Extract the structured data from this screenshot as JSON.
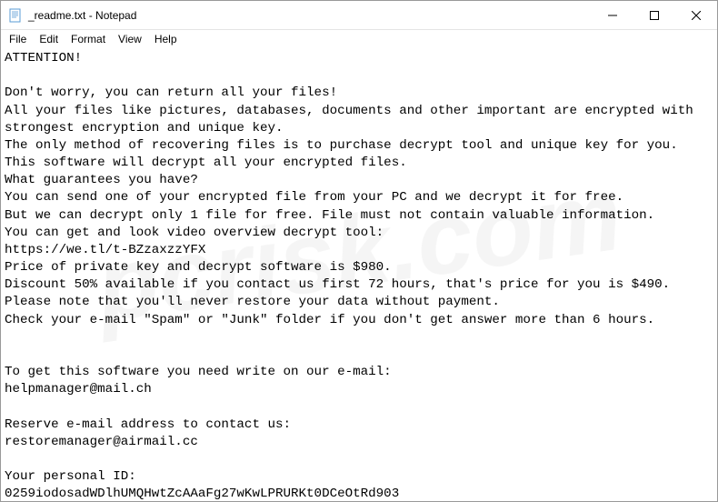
{
  "window": {
    "title": "_readme.txt - Notepad"
  },
  "menubar": {
    "items": [
      "File",
      "Edit",
      "Format",
      "View",
      "Help"
    ]
  },
  "content": {
    "text": "ATTENTION!\n\nDon't worry, you can return all your files!\nAll your files like pictures, databases, documents and other important are encrypted with strongest encryption and unique key.\nThe only method of recovering files is to purchase decrypt tool and unique key for you.\nThis software will decrypt all your encrypted files.\nWhat guarantees you have?\nYou can send one of your encrypted file from your PC and we decrypt it for free.\nBut we can decrypt only 1 file for free. File must not contain valuable information.\nYou can get and look video overview decrypt tool:\nhttps://we.tl/t-BZzaxzzYFX\nPrice of private key and decrypt software is $980.\nDiscount 50% available if you contact us first 72 hours, that's price for you is $490.\nPlease note that you'll never restore your data without payment.\nCheck your e-mail \"Spam\" or \"Junk\" folder if you don't get answer more than 6 hours.\n\n\nTo get this software you need write on our e-mail:\nhelpmanager@mail.ch\n\nReserve e-mail address to contact us:\nrestoremanager@airmail.cc\n\nYour personal ID:\n0259iodosadWDlhUMQHwtZcAAaFg27wKwLPRURKt0DCeOtRd903"
  },
  "watermark": {
    "text": "pcrisk.com"
  }
}
